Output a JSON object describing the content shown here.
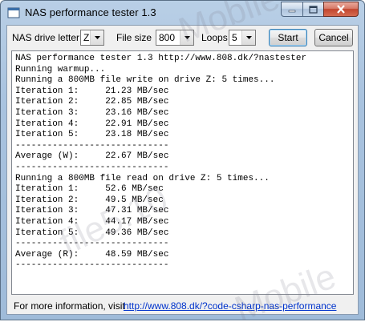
{
  "window": {
    "title": "NAS performance tester 1.3"
  },
  "controls": {
    "drive_label": "NAS drive letter",
    "drive_value": "Z",
    "filesize_label": "File size",
    "filesize_value": "800",
    "loops_label": "Loops",
    "loops_value": "5",
    "start_label": "Start",
    "cancel_label": "Cancel"
  },
  "output": {
    "lines": [
      "NAS performance tester 1.3 http://www.808.dk/?nastester",
      "Running warmup...",
      "Running a 800MB file write on drive Z: 5 times...",
      "Iteration 1:     21.23 MB/sec",
      "Iteration 2:     22.85 MB/sec",
      "Iteration 3:     23.16 MB/sec",
      "Iteration 4:     22.91 MB/sec",
      "Iteration 5:     23.18 MB/sec",
      "-----------------------------",
      "Average (W):     22.67 MB/sec",
      "-----------------------------",
      "Running a 800MB file read on drive Z: 5 times...",
      "Iteration 1:     52.6 MB/sec",
      "Iteration 2:     49.5 MB/sec",
      "Iteration 3:     47.31 MB/sec",
      "Iteration 4:     44.17 MB/sec",
      "Iteration 5:     49.36 MB/sec",
      "-----------------------------",
      "Average (R):     48.59 MB/sec",
      "-----------------------------"
    ]
  },
  "footer": {
    "info_text": "For more information, visit",
    "link_text": "http://www.808.dk/?code-csharp-nas-performance"
  },
  "watermark": {
    "text": "Mobile",
    "text2": "file5.10"
  }
}
